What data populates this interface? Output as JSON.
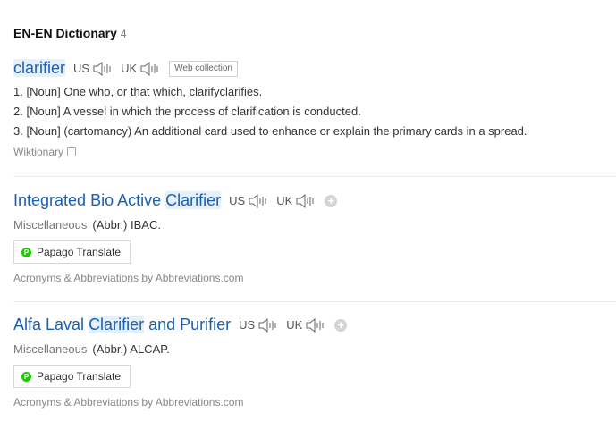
{
  "section": {
    "title": "EN-EN Dictionary",
    "count": "4"
  },
  "entries": [
    {
      "word": "clarifier",
      "us_label": "US",
      "uk_label": "UK",
      "badge": "Web collection",
      "definitions": [
        {
          "num": "1.",
          "pos": "[Noun]",
          "text": "One who, or that which, clarifyclarifies."
        },
        {
          "num": "2.",
          "pos": "[Noun]",
          "text": "A vessel in which the process of clarification is conducted."
        },
        {
          "num": "3.",
          "pos": "[Noun]",
          "text": "(cartomancy) An additional card used to enhance or explain the primary cards in a spread."
        }
      ],
      "source": "Wiktionary"
    },
    {
      "word_pre": "Integrated Bio Active ",
      "word_hl": "Clarifier",
      "word_post": "",
      "us_label": "US",
      "uk_label": "UK",
      "category": "Miscellaneous",
      "abbr_text": "(Abbr.) IBAC.",
      "translate_label": "Papago Translate",
      "source": "Acronyms & Abbreviations by Abbreviations.com"
    },
    {
      "word_pre": "Alfa Laval ",
      "word_hl": "Clarifier",
      "word_post": " and Purifier",
      "us_label": "US",
      "uk_label": "UK",
      "category": "Miscellaneous",
      "abbr_text": "(Abbr.) ALCAP.",
      "translate_label": "Papago Translate",
      "source": "Acronyms & Abbreviations by Abbreviations.com"
    }
  ],
  "colors": {
    "link": "#1a5fb4",
    "highlight": "#e6f0fb",
    "papago": "#1ec800"
  }
}
